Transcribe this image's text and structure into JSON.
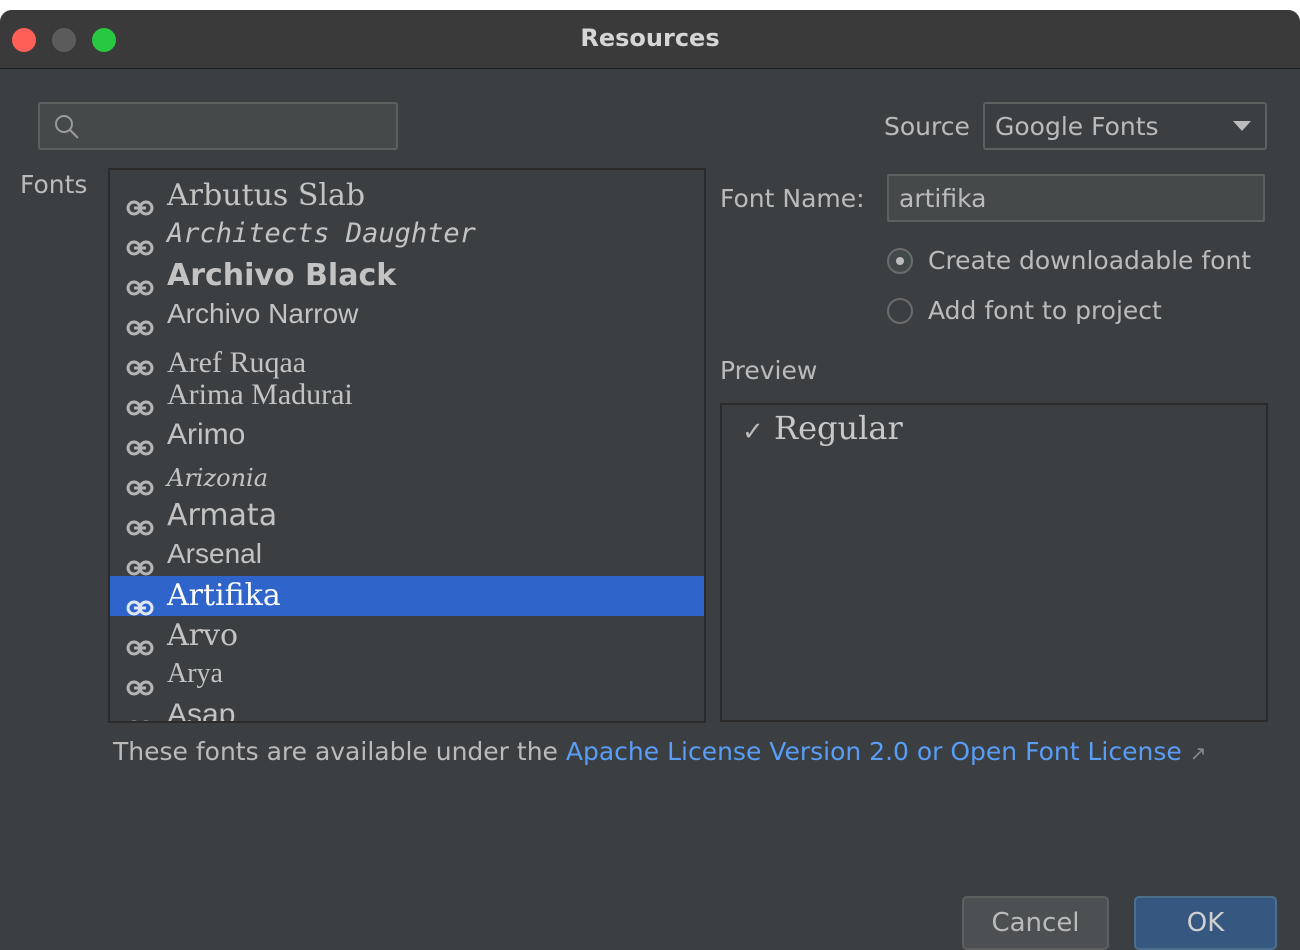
{
  "window": {
    "title": "Resources"
  },
  "search": {
    "placeholder": ""
  },
  "source": {
    "label": "Source",
    "value": "Google Fonts"
  },
  "fonts_label": "Fonts",
  "font_list": {
    "items": [
      {
        "name": "Arbutus Slab"
      },
      {
        "name": "Architects Daughter"
      },
      {
        "name": "Archivo Black"
      },
      {
        "name": "Archivo Narrow"
      },
      {
        "name": "Aref Ruqaa"
      },
      {
        "name": "Arima Madurai"
      },
      {
        "name": "Arimo"
      },
      {
        "name": "Arizonia"
      },
      {
        "name": "Armata"
      },
      {
        "name": "Arsenal"
      },
      {
        "name": "Artifika"
      },
      {
        "name": "Arvo"
      },
      {
        "name": "Arya"
      },
      {
        "name": "Asap"
      }
    ],
    "selected": "Artifika"
  },
  "font_name": {
    "label": "Font Name:",
    "value": "artifika"
  },
  "options": {
    "create_downloadable": "Create downloadable font",
    "add_to_project": "Add font to project",
    "selected": "create_downloadable"
  },
  "preview": {
    "label": "Preview",
    "check": "✓",
    "style": "Regular"
  },
  "license": {
    "text": "These fonts are available under the ",
    "link": "Apache License Version 2.0 or Open Font License",
    "arrow": "↗"
  },
  "buttons": {
    "cancel": "Cancel",
    "ok": "OK"
  },
  "colors": {
    "selection": "#2f65ca",
    "link": "#589df6",
    "background": "#3c3f41"
  }
}
